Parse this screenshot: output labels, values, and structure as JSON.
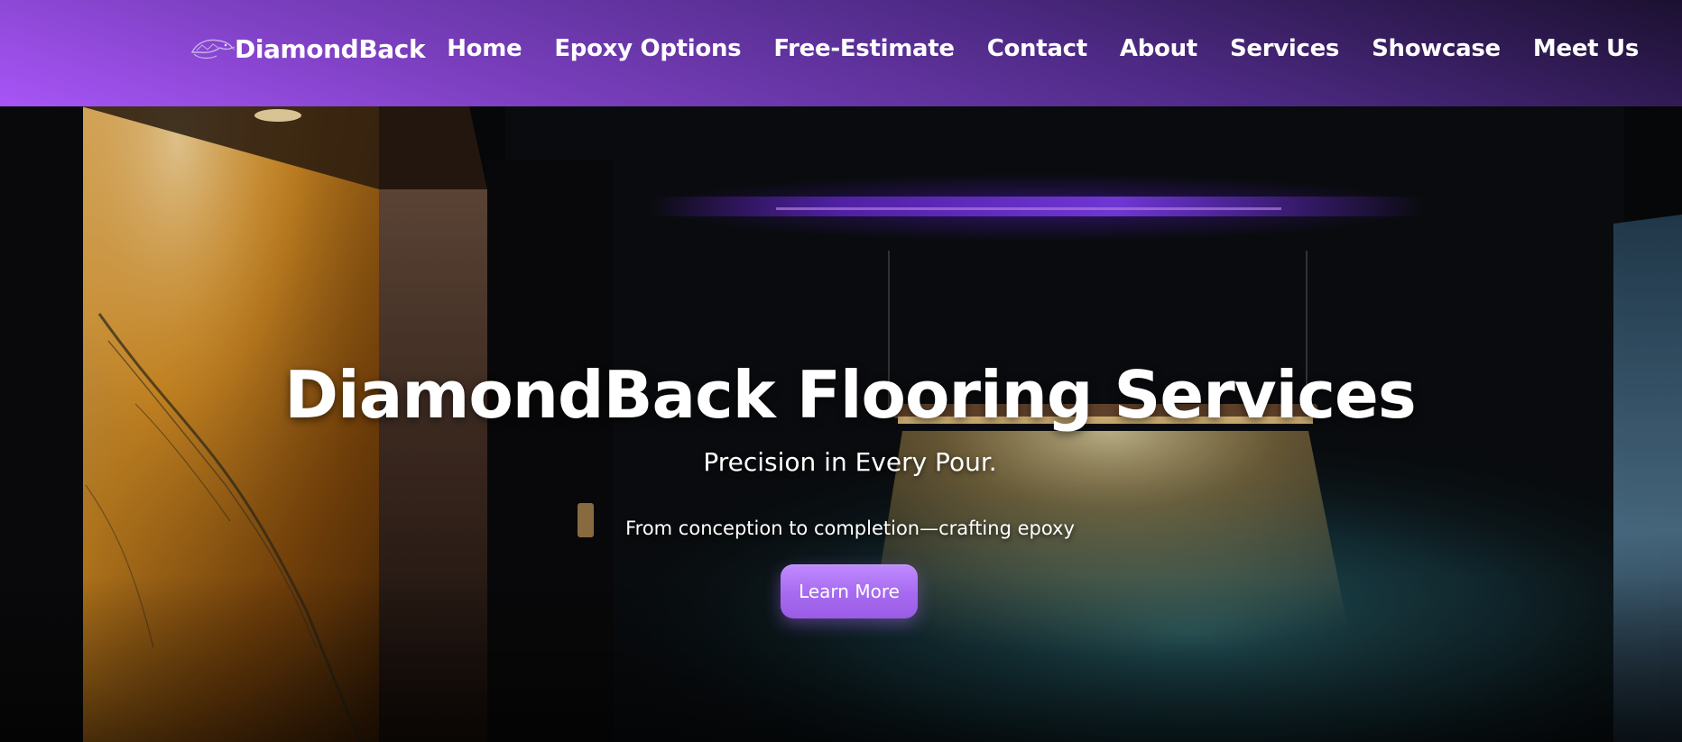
{
  "brand": {
    "name": "DiamondBack",
    "logo_icon": "snake-icon"
  },
  "nav": {
    "links": [
      {
        "label": "Home"
      },
      {
        "label": "Epoxy Options"
      },
      {
        "label": "Free-Estimate"
      },
      {
        "label": "Contact"
      },
      {
        "label": "About"
      },
      {
        "label": "Services"
      },
      {
        "label": "Showcase"
      },
      {
        "label": "Meet Us"
      }
    ]
  },
  "hero": {
    "title": "DiamondBack Flooring Services",
    "subtitle": "Precision in Every Pour.",
    "tagline": "From conception to completion—crafting epoxy",
    "cta_label": "Learn More"
  },
  "colors": {
    "accent": "#a855f7",
    "nav_gradient_start": "#a855f7",
    "nav_gradient_end": "#1b1030",
    "button": "#a66af0",
    "text": "#ffffff",
    "background": "#0a0a0c"
  }
}
